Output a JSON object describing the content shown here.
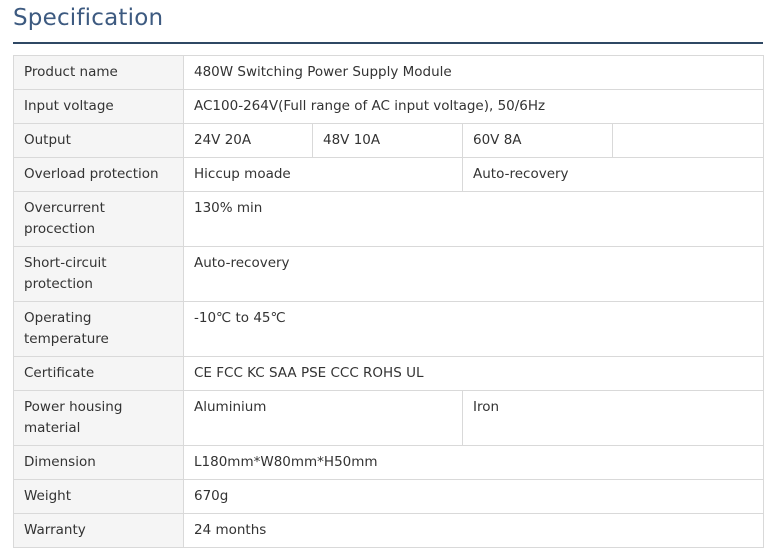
{
  "header": {
    "title": "Specification"
  },
  "rows": {
    "product_name": {
      "label": "Product name",
      "value": "480W Switching Power Supply Module"
    },
    "input_voltage": {
      "label": "Input voltage",
      "value": "AC100-264V(Full range of AC input voltage), 50/6Hz"
    },
    "output": {
      "label": "Output",
      "values": [
        "24V 20A",
        "48V 10A",
        "60V 8A",
        ""
      ]
    },
    "overload": {
      "label": "Overload protection",
      "values": [
        "Hiccup moade",
        "Auto-recovery"
      ]
    },
    "overcurrent": {
      "label": "Overcurrent procection",
      "value": "130% min"
    },
    "short_circuit": {
      "label": "Short-circuit protection",
      "value": "Auto-recovery"
    },
    "operating_temp": {
      "label": "Operating temperature",
      "value": "-10℃ to 45℃"
    },
    "certificate": {
      "label": "Certificate",
      "value": "CE FCC KC SAA PSE CCC ROHS UL"
    },
    "housing": {
      "label": "Power housing material",
      "values": [
        "Aluminium",
        "Iron"
      ]
    },
    "dimension": {
      "label": "Dimension",
      "value": "L180mm*W80mm*H50mm"
    },
    "weight": {
      "label": "Weight",
      "value": "670g"
    },
    "warranty": {
      "label": "Warranty",
      "value": "24 months"
    }
  }
}
